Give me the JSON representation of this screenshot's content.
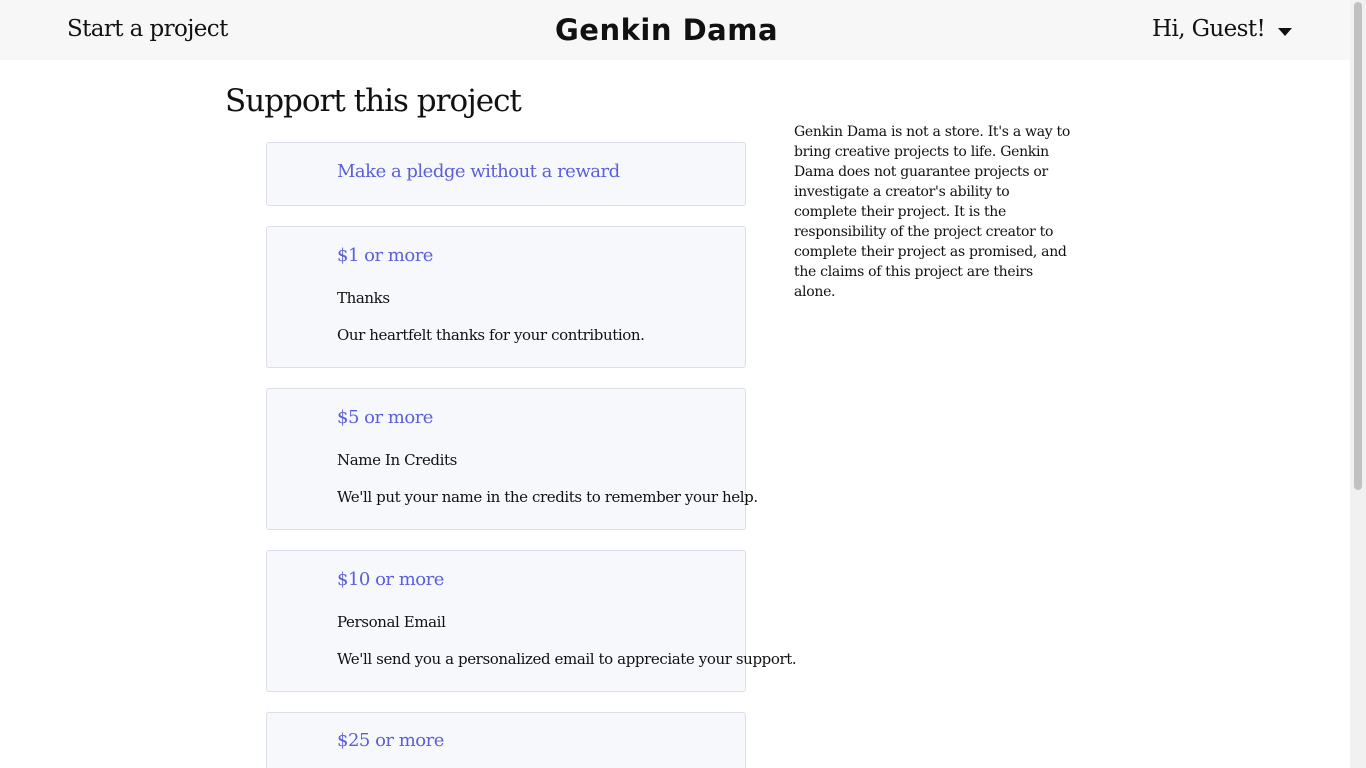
{
  "header": {
    "start_project": "Start a project",
    "brand": "Genkin Dama",
    "greeting": "Hi, Guest!"
  },
  "main": {
    "title": "Support this project",
    "no_reward": {
      "label": "Make a pledge without a reward"
    },
    "rewards": [
      {
        "amount": "$1 or more",
        "title": "Thanks",
        "description": "Our heartfelt thanks for your contribution."
      },
      {
        "amount": "$5 or more",
        "title": "Name In Credits",
        "description": "We'll put your name in the credits to remember your help."
      },
      {
        "amount": "$10 or more",
        "title": "Personal Email",
        "description": "We'll send you a personalized email to appreciate your support."
      },
      {
        "amount": "$25 or more"
      }
    ]
  },
  "sidebar": {
    "notice": "Genkin Dama is not a store. It's a way to bring creative projects to life. Genkin Dama does not guarantee projects or investigate a creator's ability to complete their project. It is the responsibility of the project creator to complete their project as promised, and the claims of this project are theirs alone."
  },
  "colors": {
    "accent": "#5b5fd8",
    "card_background": "#f7f8fc",
    "card_border": "#dcdfe8",
    "header_background": "#f7f7f8"
  },
  "icons": {
    "user_menu_toggle": "chevron-down-icon"
  }
}
